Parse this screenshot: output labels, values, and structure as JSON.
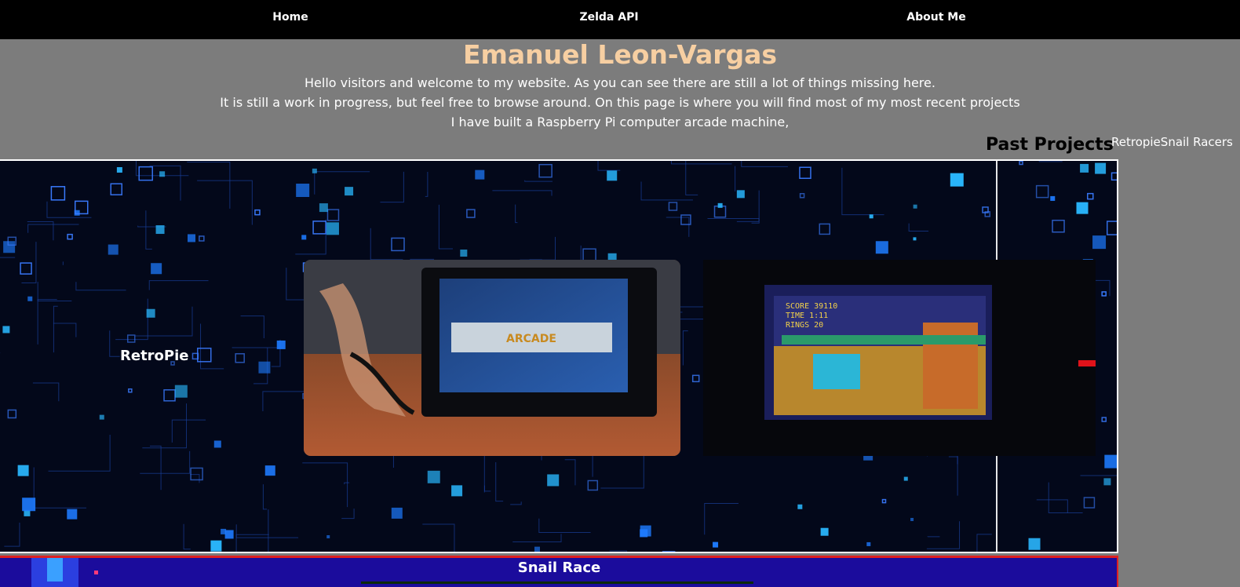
{
  "nav": {
    "home": "Home",
    "zelda": "Zelda API",
    "about": "About Me"
  },
  "hero": {
    "title": "Emanuel Leon-Vargas",
    "line1": "Hello visitors and welcome to my website. As you can see there are still a lot of things missing here.",
    "line2": "It is still a work in progress, but feel free to browse around. On this page is where you will find most of my most recent projects",
    "line3": "I have built a Raspberry Pi computer arcade machine,"
  },
  "past_projects": {
    "title": "Past Projects",
    "links": [
      "Retropie",
      "Snail Racers"
    ]
  },
  "retropie": {
    "label": "RetroPie",
    "screen_text": "ARCADE",
    "game": {
      "score": "SCORE  39110",
      "time": "TIME  1:11",
      "rings": "RINGS  20"
    }
  },
  "snail": {
    "title": "Snail Race"
  },
  "colors": {
    "title": "#f7cfa2",
    "page_bg": "#7c7c7c",
    "nav_bg": "#000000",
    "circuit_glow": "#1e7bff",
    "snail_border": "#e02020"
  }
}
